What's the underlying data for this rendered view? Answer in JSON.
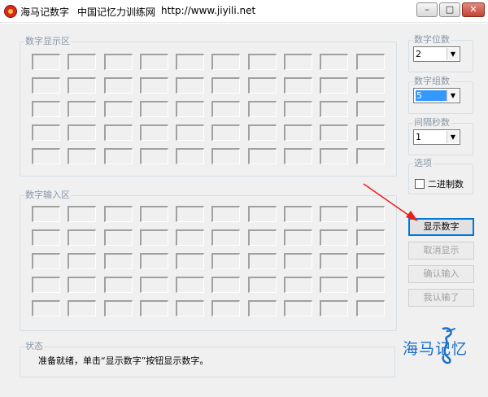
{
  "window": {
    "title_app": "海马记数字",
    "title_org": "中国记忆力训练网",
    "title_url": "http://www.jiyili.net",
    "min_glyph": "–",
    "max_glyph": "□",
    "close_glyph": "✕"
  },
  "display_group": {
    "legend": "数字显示区",
    "rows": 5,
    "cols": 10
  },
  "input_group": {
    "legend": "数字输入区",
    "rows": 5,
    "cols": 10
  },
  "settings": {
    "digit_count": {
      "legend": "数字位数",
      "value": "2"
    },
    "group_count": {
      "legend": "数字组数",
      "value": "5"
    },
    "interval_seconds": {
      "legend": "间隔秒数",
      "value": "1"
    },
    "options": {
      "legend": "选项",
      "binary_label": "二进制数",
      "binary_checked": false
    }
  },
  "buttons": {
    "show_digits": "显示数字",
    "cancel_show": "取消显示",
    "confirm_input": "确认输入",
    "give_up": "我认输了"
  },
  "status": {
    "legend": "状态",
    "message": "准备就绪，单击“显示数字”按钮显示数字。"
  },
  "logo": {
    "text": "海马记忆"
  },
  "colors": {
    "arrow": "#e8201c",
    "accent": "#0078d7",
    "logo": "#1a6fc9"
  }
}
